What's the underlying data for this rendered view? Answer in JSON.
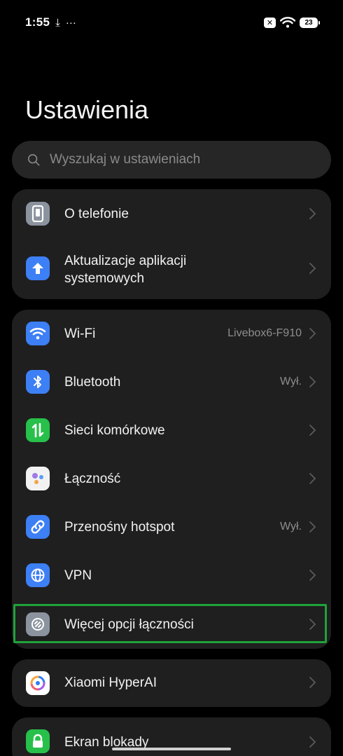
{
  "status_bar": {
    "time": "1:55",
    "download_icon": "⤓",
    "more_icon": "···",
    "battery": "23"
  },
  "title": "Ustawienia",
  "search": {
    "placeholder": "Wyszukaj w ustawieniach"
  },
  "groups": [
    {
      "items": [
        {
          "label": "O telefonie",
          "value": "",
          "icon": "phone-icon",
          "color": "#8b939e"
        },
        {
          "label": "Aktualizacje aplikacji systemowych",
          "value": "",
          "icon": "arrow-up-icon",
          "color": "#3d7ff5"
        }
      ]
    },
    {
      "items": [
        {
          "label": "Wi-Fi",
          "value": "Livebox6-F910",
          "icon": "wifi-icon",
          "color": "#3d7ff5"
        },
        {
          "label": "Bluetooth",
          "value": "Wył.",
          "icon": "bluetooth-icon",
          "color": "#3d7ff5"
        },
        {
          "label": "Sieci komórkowe",
          "value": "",
          "icon": "cellular-icon",
          "color": "#27c04a"
        },
        {
          "label": "Łączność",
          "value": "",
          "icon": "connectivity-icon",
          "color": "#f2f2f2"
        },
        {
          "label": "Przenośny hotspot",
          "value": "Wył.",
          "icon": "hotspot-icon",
          "color": "#3d7ff5"
        },
        {
          "label": "VPN",
          "value": "",
          "icon": "globe-icon",
          "color": "#3d7ff5"
        },
        {
          "label": "Więcej opcji łączności",
          "value": "",
          "icon": "link-icon",
          "color": "#8b939e"
        }
      ]
    },
    {
      "items": [
        {
          "label": "Xiaomi HyperAI",
          "value": "",
          "icon": "hyperai-icon",
          "color": "#ffffff"
        }
      ]
    },
    {
      "items": [
        {
          "label": "Ekran blokady",
          "value": "",
          "icon": "lock-icon",
          "color": "#27c04a"
        }
      ]
    }
  ]
}
